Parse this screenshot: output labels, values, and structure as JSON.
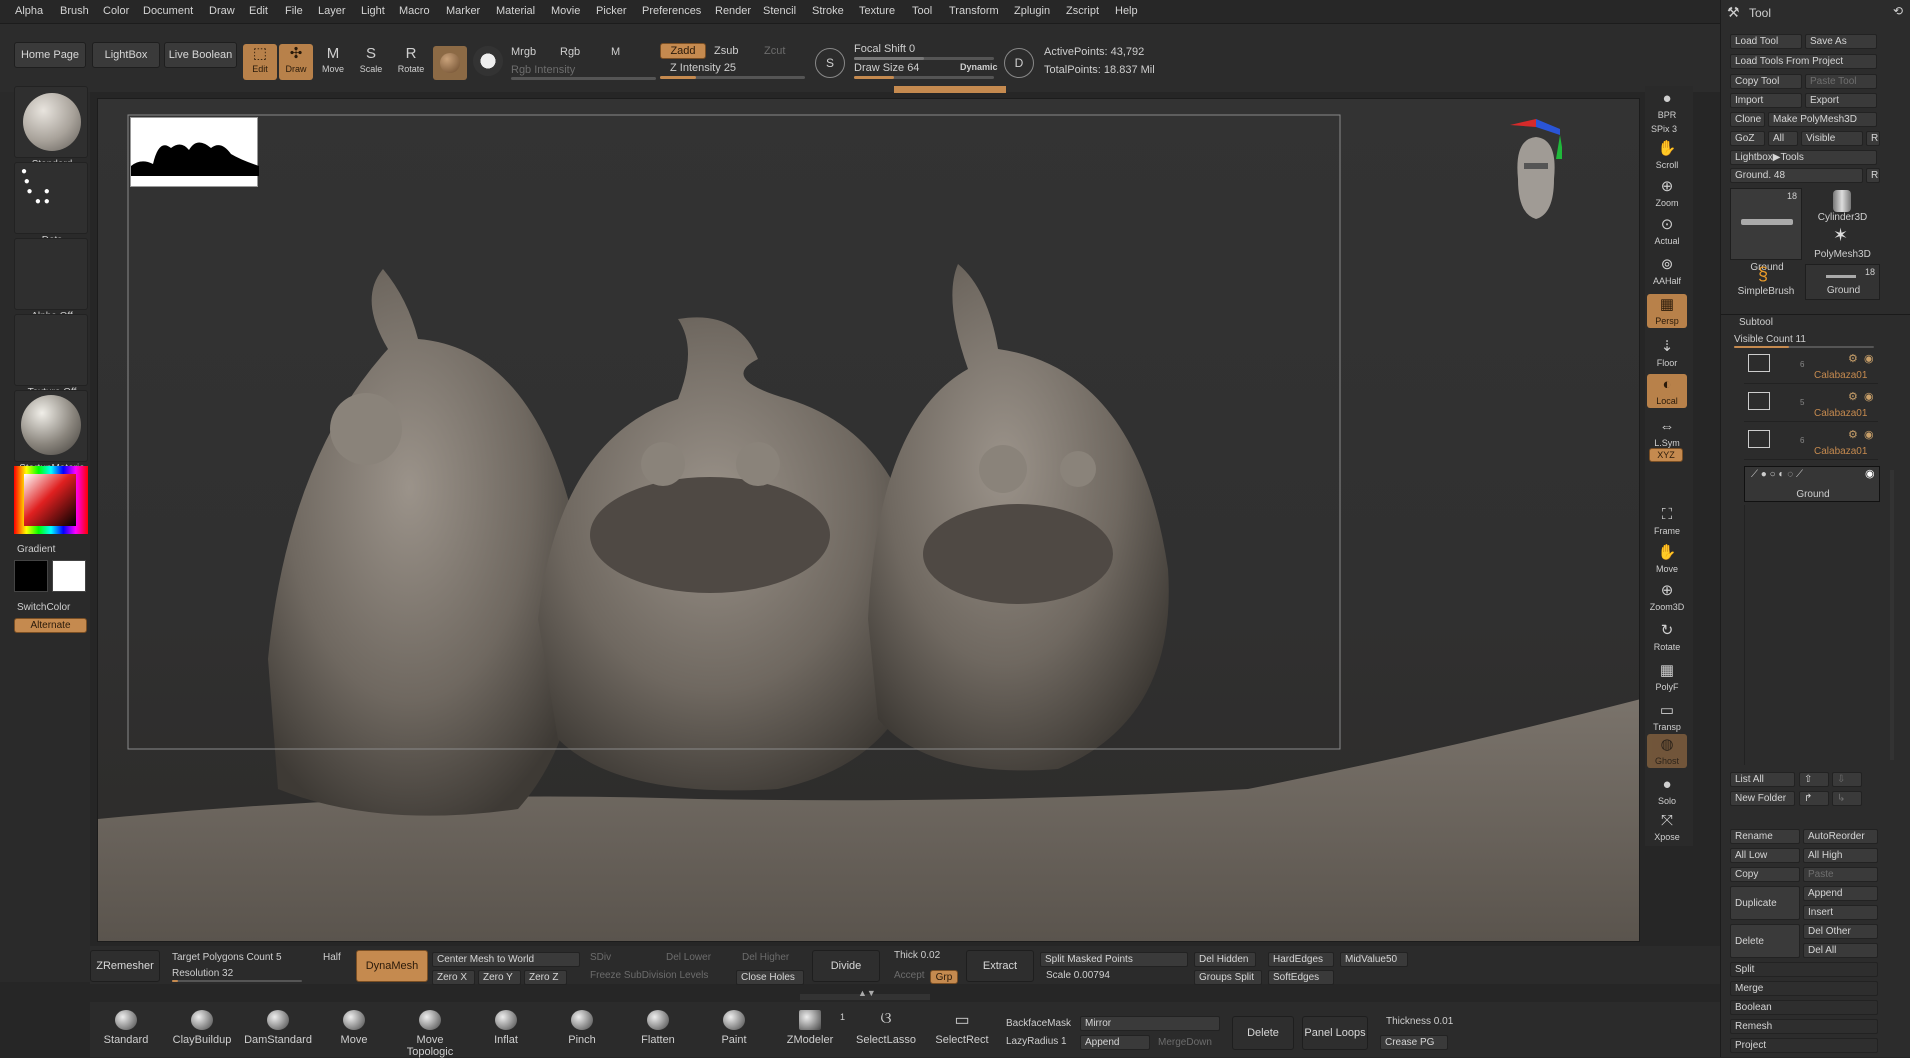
{
  "menu": [
    "Alpha",
    "Brush",
    "Color",
    "Document",
    "Draw",
    "Edit",
    "File",
    "Layer",
    "Light",
    "Macro",
    "Marker",
    "Material",
    "Movie",
    "Picker",
    "Preferences",
    "Render",
    "Stencil",
    "Stroke",
    "Texture",
    "Tool",
    "Transform",
    "Zplugin",
    "Zscript",
    "Help"
  ],
  "toolbar": {
    "home_page": "Home Page",
    "lightbox": "LightBox",
    "live_boolean": "Live Boolean",
    "edit": "Edit",
    "draw": "Draw",
    "move": "Move",
    "scale": "Scale",
    "rotate": "Rotate",
    "mrgb": "Mrgb",
    "rgb": "Rgb",
    "m": "M",
    "rgb_intensity": "Rgb Intensity",
    "zadd": "Zadd",
    "zsub": "Zsub",
    "zcut": "Zcut",
    "z_intensity_label": "Z Intensity",
    "z_intensity_value": "25",
    "focal_shift_label": "Focal Shift",
    "focal_shift_value": "0",
    "draw_size_label": "Draw Size",
    "draw_size_value": "64",
    "dynamic": "Dynamic",
    "active_points": "ActivePoints: 43,792",
    "total_points": "TotalPoints: 18.837 Mil"
  },
  "shelf": {
    "brush": "Standard",
    "stroke": "Dots",
    "alpha": "Alpha Off",
    "texture": "Texture Off",
    "material": "StartupMateria",
    "gradient": "Gradient",
    "switch_color": "SwitchColor",
    "alternate": "Alternate"
  },
  "rightbar": [
    "BPR",
    "SPix 3",
    "Scroll",
    "Zoom",
    "Actual",
    "AAHalf",
    "Persp",
    "Floor",
    "Local",
    "L.Sym",
    "XYZ",
    "Frame",
    "Move",
    "Zoom3D",
    "Rotate",
    "PolyF",
    "Transp",
    "Ghost",
    "Solo",
    "Xpose"
  ],
  "tool": {
    "title": "Tool",
    "load_tool": "Load Tool",
    "save_as": "Save As",
    "load_from_project": "Load Tools From Project",
    "copy_tool": "Copy Tool",
    "paste_tool": "Paste Tool",
    "import": "Import",
    "export": "Export",
    "clone": "Clone",
    "make_polymesh": "Make PolyMesh3D",
    "goz": "GoZ",
    "all": "All",
    "visible": "Visible",
    "r": "R",
    "lightbox_tools": "Lightbox▶Tools",
    "ground_slider": "Ground. 48",
    "thumbs": [
      {
        "name": "Ground",
        "count": "18"
      },
      {
        "name": "Cylinder3D",
        "count": ""
      },
      {
        "name": "PolyMesh3D",
        "count": ""
      },
      {
        "name": "SimpleBrush",
        "count": ""
      },
      {
        "name": "Ground",
        "count": "18"
      }
    ],
    "subtool": "Subtool",
    "visible_count": "Visible Count 11",
    "subtools": [
      {
        "name": "Calabaza01",
        "num": "6"
      },
      {
        "name": "Calabaza01",
        "num": "5"
      },
      {
        "name": "Calabaza01",
        "num": "6"
      }
    ],
    "active_subtool": "Ground",
    "list_all": "List All",
    "new_folder": "New Folder",
    "rename": "Rename",
    "auto_reorder": "AutoReorder",
    "all_low": "All Low",
    "all_high": "All High",
    "copy": "Copy",
    "paste": "Paste",
    "duplicate": "Duplicate",
    "append": "Append",
    "insert": "Insert",
    "delete": "Delete",
    "del_other": "Del Other",
    "del_all": "Del All",
    "split": "Split",
    "merge": "Merge",
    "boolean": "Boolean",
    "remesh": "Remesh",
    "project": "Project"
  },
  "bottom1": {
    "zremesher": "ZRemesher",
    "target_poly": "Target Polygons Count 5",
    "half": "Half",
    "resolution": "Resolution 32",
    "dynamesh": "DynaMesh",
    "center_mesh": "Center Mesh to World",
    "sdiv": "SDiv",
    "del_lower": "Del Lower",
    "del_higher": "Del Higher",
    "zero_x": "Zero X",
    "zero_y": "Zero Y",
    "zero_z": "Zero Z",
    "freeze": "Freeze SubDivision Levels",
    "close_holes": "Close Holes",
    "divide": "Divide",
    "thick": "Thick 0.02",
    "accept": "Accept",
    "grp": "Grp",
    "extract": "Extract",
    "split_masked": "Split Masked Points",
    "scale": "Scale 0.00794",
    "del_hidden": "Del Hidden",
    "groups_split": "Groups Split",
    "hard_edges": "HardEdges",
    "soft_edges": "SoftEdges",
    "midvalue": "MidValue50"
  },
  "bottom2": {
    "brushes": [
      "Standard",
      "ClayBuildup",
      "DamStandard",
      "Move",
      "Move Topologic",
      "Inflat",
      "Pinch",
      "Flatten",
      "Paint",
      "ZModeler",
      "SelectLasso",
      "SelectRect"
    ],
    "zmodeler_count": "1",
    "backface_mask": "BackfaceMask",
    "lazy_radius": "LazyRadius 1",
    "mirror": "Mirror",
    "append": "Append",
    "merge_down": "MergeDown",
    "delete": "Delete",
    "panel_loops": "Panel Loops",
    "thickness": "Thickness 0.01",
    "crease_pg": "Crease PG"
  }
}
